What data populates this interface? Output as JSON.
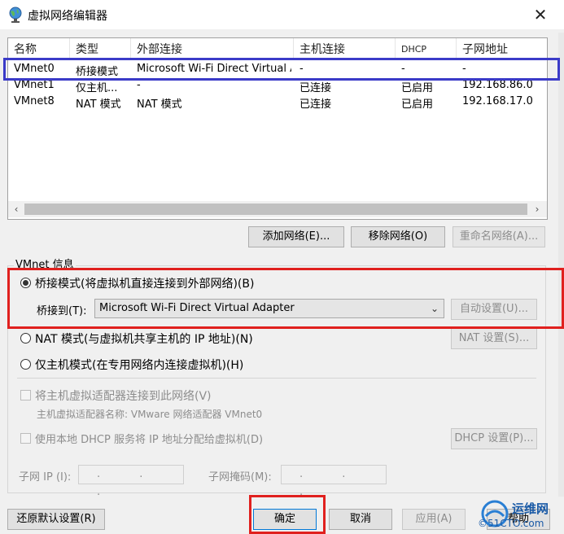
{
  "window": {
    "title": "虚拟网络编辑器",
    "close_glyph": "✕"
  },
  "network_table": {
    "columns": [
      "名称",
      "类型",
      "外部连接",
      "主机连接",
      "DHCP",
      "子网地址"
    ],
    "rows": [
      {
        "name": "VMnet0",
        "type": "桥接模式",
        "external": "Microsoft Wi-Fi Direct Virtual A...",
        "host": "-",
        "dhcp": "-",
        "subnet": "-"
      },
      {
        "name": "VMnet1",
        "type": "仅主机...",
        "external": "-",
        "host": "已连接",
        "dhcp": "已启用",
        "subnet": "192.168.86.0"
      },
      {
        "name": "VMnet8",
        "type": "NAT 模式",
        "external": "NAT 模式",
        "host": "已连接",
        "dhcp": "已启用",
        "subnet": "192.168.17.0"
      }
    ],
    "scroll_left": "‹",
    "scroll_right": "›"
  },
  "table_buttons": {
    "add": "添加网络(E)...",
    "remove": "移除网络(O)",
    "rename": "重命名网络(A)..."
  },
  "vmnet_info": {
    "group_label": "VMnet 信息",
    "bridged_label": "桥接模式(将虚拟机直接连接到外部网络)(B)",
    "bridge_to_label": "桥接到(T):",
    "bridge_to_value": "Microsoft Wi-Fi Direct Virtual Adapter",
    "auto_settings": "自动设置(U)...",
    "nat_label": "NAT 模式(与虚拟机共享主机的 IP 地址)(N)",
    "nat_settings": "NAT 设置(S)...",
    "hostonly_label": "仅主机模式(在专用网络内连接虚拟机)(H)",
    "connect_adapter_label": "将主机虚拟适配器连接到此网络(V)",
    "adapter_name_label": "主机虚拟适配器名称: VMware 网络适配器 VMnet0",
    "dhcp_label": "使用本地 DHCP 服务将 IP 地址分配给虚拟机(D)",
    "dhcp_settings": "DHCP 设置(P)...",
    "subnet_ip_label": "子网 IP (I):",
    "subnet_mask_label": "子网掩码(M):",
    "ip_placeholder": ". . .",
    "selected_mode": "bridged"
  },
  "footer_buttons": {
    "restore": "还原默认设置(R)",
    "ok": "确定",
    "cancel": "取消",
    "apply": "应用(A)",
    "help": "帮助"
  },
  "watermark": {
    "brand": "运维网",
    "site": "©51CTO.com"
  },
  "colors": {
    "annotation_blue": "#3b3bc8",
    "annotation_red": "#e0201e"
  }
}
